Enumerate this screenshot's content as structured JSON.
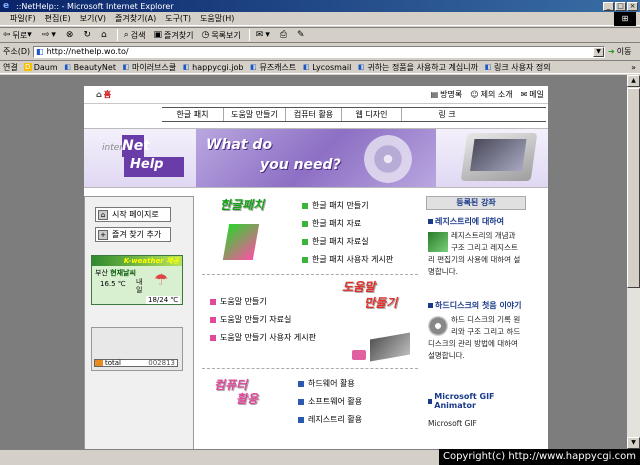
{
  "window": {
    "title": "::NetHelp:: - Microsoft Internet Explorer"
  },
  "menu": [
    "파일(F)",
    "편집(E)",
    "보기(V)",
    "즐겨찾기(A)",
    "도구(T)",
    "도움말(H)"
  ],
  "toolbar": {
    "back": "뒤로",
    "search": "검색",
    "favorites": "즐겨찾기",
    "history": "목록보기"
  },
  "address": {
    "label": "주소(D)",
    "url": "http://nethelp.wo.to/",
    "go": "이동"
  },
  "links": {
    "label": "연결",
    "items": [
      "Daum",
      "BeautyNet",
      "마이러브스쿨",
      "happycgi.job",
      "뮤즈캐스트",
      "Lycosmail",
      "귀하는 정품을 사용하고 계십니까",
      "링크 사용자 정의"
    ]
  },
  "page": {
    "home_label": "홈",
    "top_links": [
      "방명록",
      "제의 소개",
      "메일"
    ],
    "nav": [
      "한글 패치",
      "도움말 만들기",
      "컴퓨터 활용",
      "웹 디자인",
      "링 크"
    ],
    "logo": {
      "inter": "inter",
      "net": "Net",
      "help": "Help"
    },
    "banner": {
      "line1": "What do",
      "line2": "you need?"
    },
    "left": {
      "start_page": "시작 페이지로",
      "add_favorite": "즐겨 찾기 추가",
      "weather": {
        "brand": "K-weather 제공",
        "city": "부산",
        "current": "현재날씨",
        "temp": "16.5 ℃",
        "day": "내일",
        "range": "18/24 ℃"
      },
      "counter": {
        "label": "total",
        "value": "002813"
      }
    },
    "sections": {
      "hangul": {
        "title": "한글패치",
        "items": [
          "한글 패치 만들기",
          "한글 패치 자료",
          "한글 패치 자료실",
          "한글 패치 사용자 게시판"
        ]
      },
      "help": {
        "title_line1": "도움말",
        "title_line2": "만들기",
        "items": [
          "도움말 만들기",
          "도움말 만들기 자료실",
          "도움말 만들기 사용자 게시판"
        ]
      },
      "computer": {
        "title_line1": "컴퓨터",
        "title_line2": "활용",
        "items": [
          "하드웨어 활용",
          "소프트웨어 활용",
          "레지스트리 활용"
        ]
      }
    },
    "right": {
      "header": "등록된 강좌",
      "articles": [
        {
          "title": "레지스트리에 대하여",
          "body": "레지스트리의 개념과 구조 그리고 레지스트리 편집기의 사용에 대하여 설명합니다."
        },
        {
          "title": "하드디스크의 첫음 이야기",
          "body": "하드 디스크의 기록 원리와 구조 그리고 하드 디스크의 관리 방법에 대하여 설명합니다."
        },
        {
          "title": "Microsoft GIF Animator",
          "body": "Microsoft GIF"
        }
      ]
    }
  },
  "footer": {
    "copyright": "Copyright(c) http://www.happycgi.com"
  },
  "colors": {
    "accent_purple": "#6a3ca8",
    "title_blue": "#1a3a8a",
    "hangul_green": "#18a018",
    "help_red": "#e0302a",
    "computer_pink": "#e04a9a"
  }
}
